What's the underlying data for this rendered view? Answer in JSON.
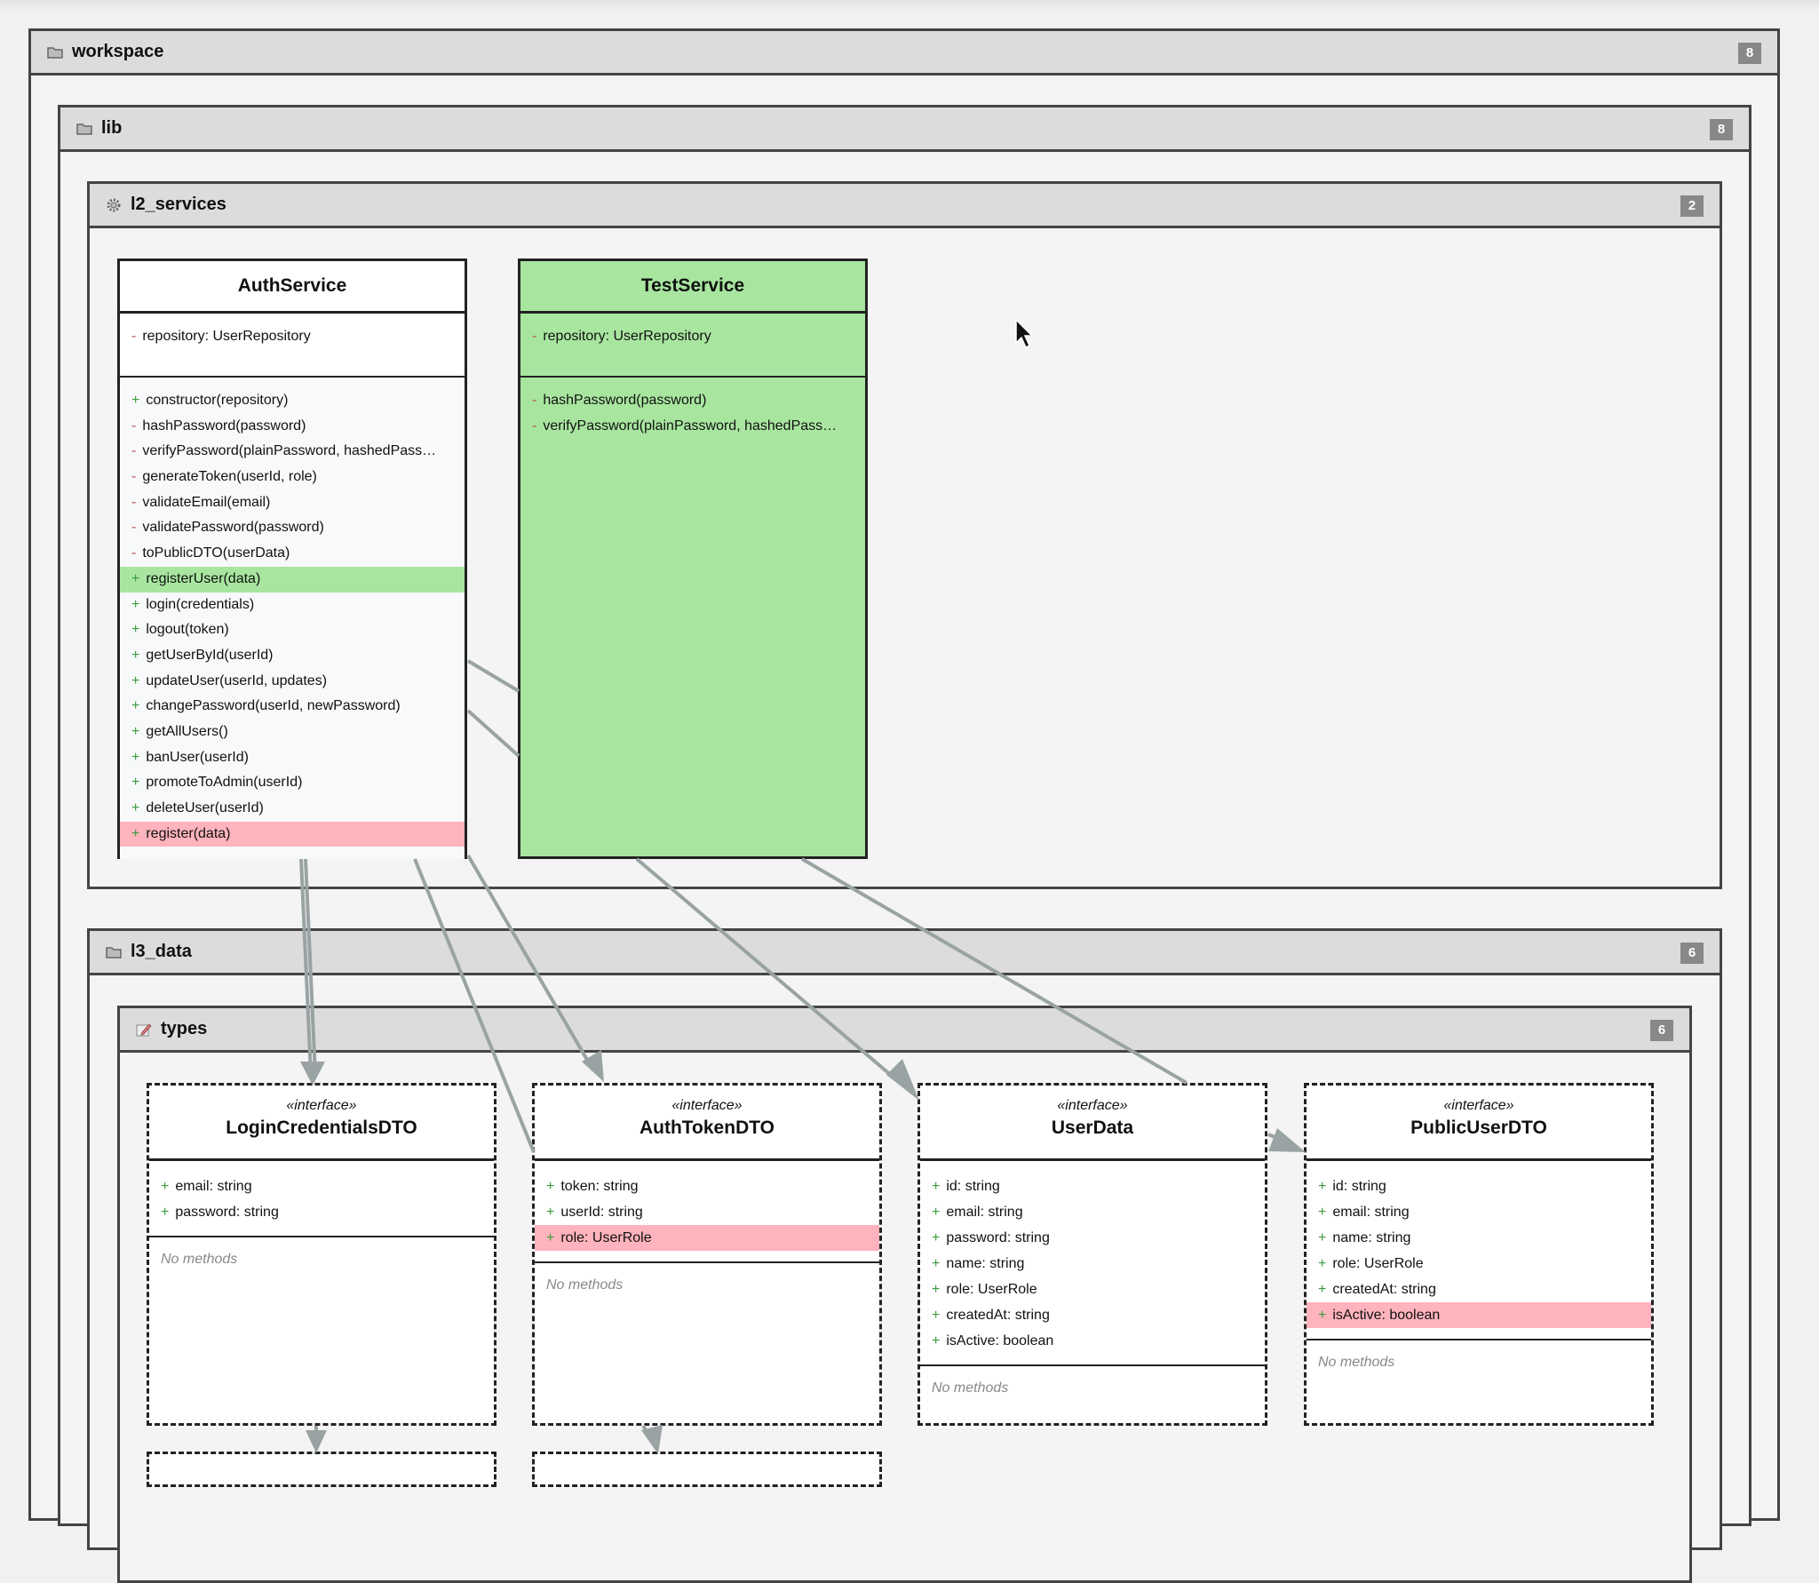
{
  "packages": {
    "workspace": {
      "name": "workspace",
      "count": "8"
    },
    "lib": {
      "name": "lib",
      "count": "8"
    },
    "l2_services": {
      "name": "l2_services",
      "count": "2"
    },
    "l3_data": {
      "name": "l3_data",
      "count": "6"
    },
    "types": {
      "name": "types",
      "count": "6"
    }
  },
  "classes": {
    "auth_service": {
      "name": "AuthService",
      "attributes": [
        {
          "vis": "-",
          "text": "repository: UserRepository"
        }
      ],
      "methods": [
        {
          "vis": "+",
          "text": "constructor(repository)"
        },
        {
          "vis": "-",
          "text": "hashPassword(password)"
        },
        {
          "vis": "-",
          "text": "verifyPassword(plainPassword, hashedPass…"
        },
        {
          "vis": "-",
          "text": "generateToken(userId, role)"
        },
        {
          "vis": "-",
          "text": "validateEmail(email)"
        },
        {
          "vis": "-",
          "text": "validatePassword(password)"
        },
        {
          "vis": "-",
          "text": "toPublicDTO(userData)"
        },
        {
          "vis": "+",
          "text": "registerUser(data)"
        },
        {
          "vis": "+",
          "text": "login(credentials)"
        },
        {
          "vis": "+",
          "text": "logout(token)"
        },
        {
          "vis": "+",
          "text": "getUserById(userId)"
        },
        {
          "vis": "+",
          "text": "updateUser(userId, updates)"
        },
        {
          "vis": "+",
          "text": "changePassword(userId, newPassword)"
        },
        {
          "vis": "+",
          "text": "getAllUsers()"
        },
        {
          "vis": "+",
          "text": "banUser(userId)"
        },
        {
          "vis": "+",
          "text": "promoteToAdmin(userId)"
        },
        {
          "vis": "+",
          "text": "deleteUser(userId)"
        },
        {
          "vis": "+",
          "text": "register(data)"
        }
      ]
    },
    "test_service": {
      "name": "TestService",
      "attributes": [
        {
          "vis": "-",
          "text": "repository: UserRepository"
        }
      ],
      "methods": [
        {
          "vis": "-",
          "text": "hashPassword(password)"
        },
        {
          "vis": "-",
          "text": "verifyPassword(plainPassword, hashedPass…"
        }
      ]
    },
    "login_credentials_dto": {
      "stereotype": "«interface»",
      "name": "LoginCredentialsDTO",
      "attributes": [
        {
          "vis": "+",
          "text": "email: string"
        },
        {
          "vis": "+",
          "text": "password: string"
        }
      ],
      "no_methods": "No methods"
    },
    "auth_token_dto": {
      "stereotype": "«interface»",
      "name": "AuthTokenDTO",
      "attributes": [
        {
          "vis": "+",
          "text": "token: string"
        },
        {
          "vis": "+",
          "text": "userId: string"
        },
        {
          "vis": "+",
          "text": "role: UserRole"
        }
      ],
      "no_methods": "No methods"
    },
    "user_data": {
      "stereotype": "«interface»",
      "name": "UserData",
      "attributes": [
        {
          "vis": "+",
          "text": "id: string"
        },
        {
          "vis": "+",
          "text": "email: string"
        },
        {
          "vis": "+",
          "text": "password: string"
        },
        {
          "vis": "+",
          "text": "name: string"
        },
        {
          "vis": "+",
          "text": "role: UserRole"
        },
        {
          "vis": "+",
          "text": "createdAt: string"
        },
        {
          "vis": "+",
          "text": "isActive: boolean"
        }
      ],
      "no_methods": "No methods"
    },
    "public_user_dto": {
      "stereotype": "«interface»",
      "name": "PublicUserDTO",
      "attributes": [
        {
          "vis": "+",
          "text": "id: string"
        },
        {
          "vis": "+",
          "text": "email: string"
        },
        {
          "vis": "+",
          "text": "name: string"
        },
        {
          "vis": "+",
          "text": "role: UserRole"
        },
        {
          "vis": "+",
          "text": "createdAt: string"
        },
        {
          "vis": "+",
          "text": "isActive: boolean"
        }
      ],
      "no_methods": "No methods"
    }
  },
  "colors": {
    "added": "#a8e6a0",
    "removed": "#ffb3bc",
    "edge": "#9aa3a3"
  },
  "icons": {
    "package": "folder-icon",
    "services": "gear-icon",
    "types": "pencil-icon",
    "cursor": "mouse-pointer-icon"
  }
}
